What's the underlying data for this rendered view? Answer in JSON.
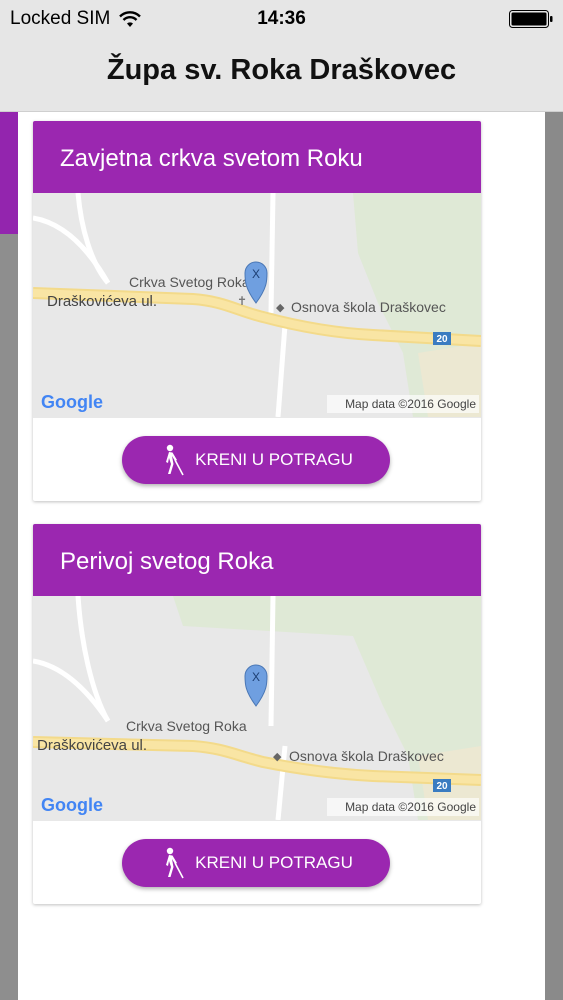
{
  "status_bar": {
    "carrier": "Locked SIM",
    "time": "14:36"
  },
  "nav": {
    "title": "Župa sv. Roka Draškovec"
  },
  "colors": {
    "accent": "#9b27b0",
    "nav_background": "#e6e6e6"
  },
  "cards": [
    {
      "title": "Zavjetna crkva svetom Roku",
      "map": {
        "church_label": "Crkva Svetog Roka",
        "street_label": "Draškovićeva ul.",
        "school_label": "Osnova škola Draškovec",
        "road_number": "20",
        "attribution": "Map data ©2016 Google",
        "logo": "Google",
        "marker_letter": "X"
      },
      "button_label": "KRENI U POTRAGU",
      "button_icon": "walking-person-icon"
    },
    {
      "title": "Perivoj svetog Roka",
      "map": {
        "church_label": "Crkva Svetog Roka",
        "street_label": "Draškovićeva ul.",
        "school_label": "Osnova škola Draškovec",
        "road_number": "20",
        "attribution": "Map data ©2016 Google",
        "logo": "Google",
        "marker_letter": "X"
      },
      "button_label": "KRENI U POTRAGU",
      "button_icon": "walking-person-icon"
    }
  ]
}
